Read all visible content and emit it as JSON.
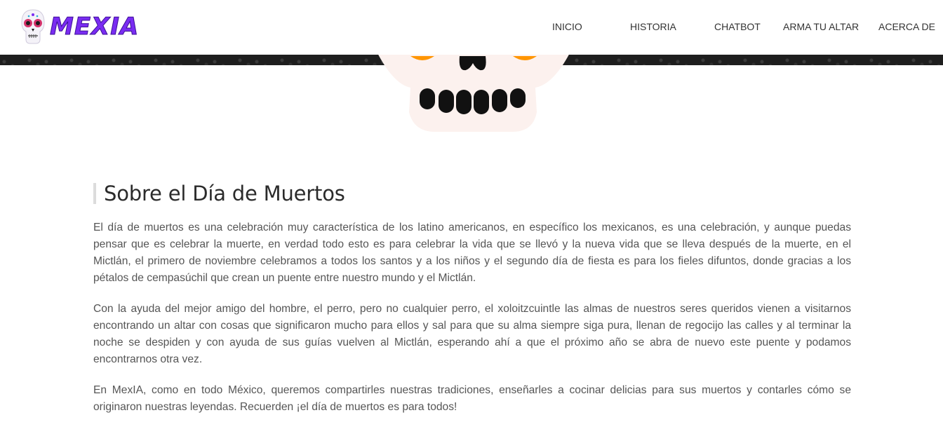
{
  "brand": {
    "name": "MEXIA",
    "logo_icon": "sugar-skull-icon",
    "text_color": "#7a2cf2"
  },
  "nav": {
    "items": [
      {
        "label": "INICIO"
      },
      {
        "label": "HISTORIA"
      },
      {
        "label": "CHATBOT"
      },
      {
        "label": "ARMA TU ALTAR"
      },
      {
        "label": "ACERCA DE"
      }
    ]
  },
  "hero": {
    "icon": "skull-icon",
    "background": "#1e1e1e",
    "skull_color": "#fcf1ee",
    "eye_color": "#ff9500"
  },
  "section": {
    "title": "Sobre el Día de Muertos",
    "paragraphs": [
      "El día de muertos es una celebración muy característica de los latino americanos, en específico los mexicanos, es una celebración, y aunque puedas pensar que es celebrar la muerte, en verdad todo esto es para celebrar la vida que se llevó y la nueva vida que se lleva después de la muerte, en el Mictlán, el primero de noviembre celebramos a todos los santos y a los niños y el segundo día de fiesta es para los fieles difuntos, donde gracias a los pétalos de cempasúchil que crean un puente entre nuestro mundo y el Mictlán.",
      "Con la ayuda del mejor amigo del hombre, el perro, pero no cualquier perro, el xoloitzcuintle las almas de nuestros seres queridos vienen a visitarnos encontrando un altar con cosas que significaron mucho para ellos y sal para que su alma siempre siga pura, llenan de regocijo las calles y al terminar la noche se despiden y con ayuda de sus guías vuelven al Mictlán, esperando ahí a que el próximo año se abra de nuevo este puente y podamos encontrarnos otra vez.",
      "En MexIA, como en todo México, queremos compartirles nuestras tradiciones, enseñarles a cocinar delicias para sus muertos y contarles cómo se originaron nuestras leyendas. Recuerden ¡el día de muertos es para todos!"
    ]
  }
}
